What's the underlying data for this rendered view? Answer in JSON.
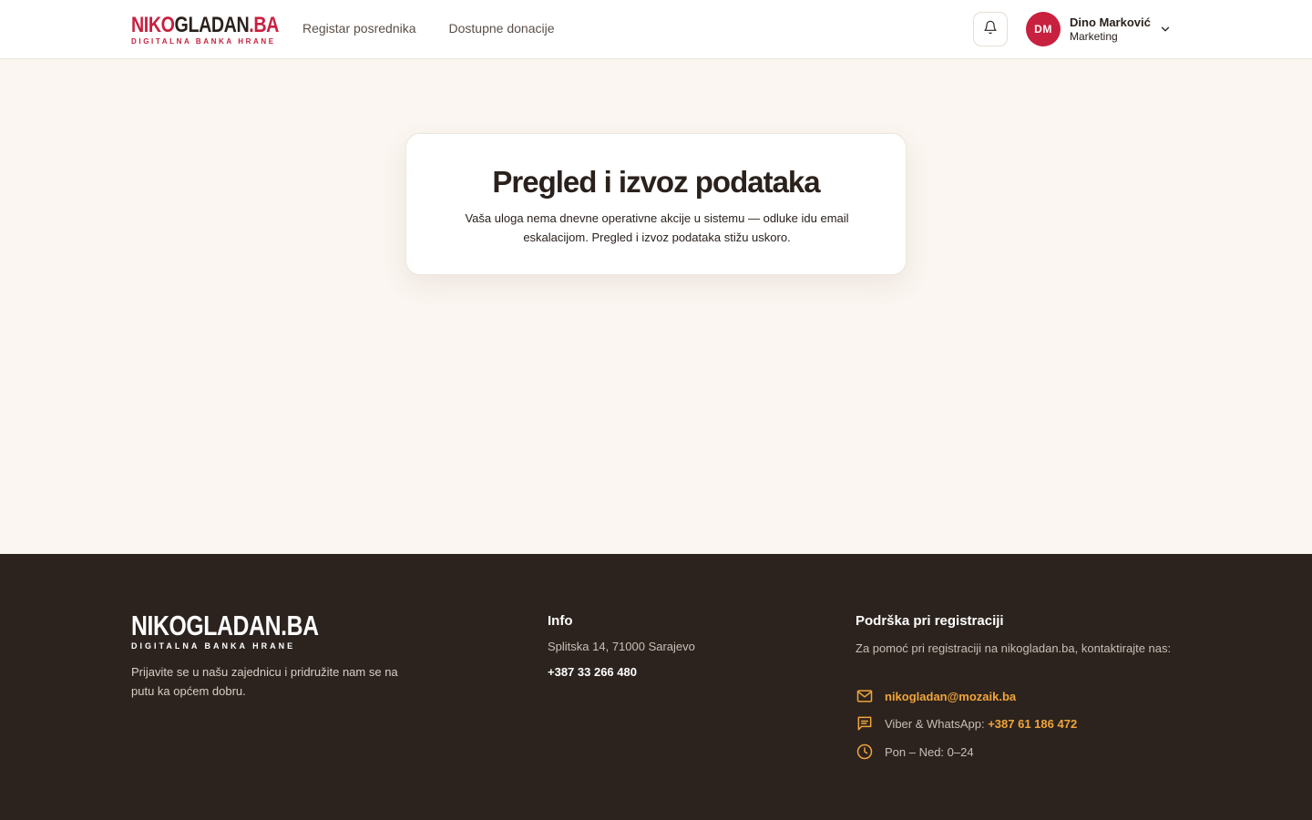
{
  "header": {
    "logo": {
      "part1": "NIKO",
      "part2": "GLADAN",
      "part3": ".BA",
      "tagline": "DIGITALNA BANKA HRANE"
    },
    "nav": [
      {
        "label": "Registar posrednika"
      },
      {
        "label": "Dostupne donacije"
      }
    ],
    "user": {
      "initials": "DM",
      "name": "Dino Marković",
      "role": "Marketing"
    }
  },
  "main": {
    "title": "Pregled i izvoz podataka",
    "description": "Vaša uloga nema dnevne operativne akcije u sistemu — odluke idu email eskalacijom. Pregled i izvoz podataka stižu uskoro."
  },
  "footer": {
    "logo": {
      "main": "NIKOGLADAN.BA",
      "tagline": "DIGITALNA BANKA HRANE"
    },
    "description": "Prijavite se u našu zajednicu i pridružite nam se na putu ka općem dobru.",
    "info": {
      "title": "Info",
      "address": "Splitska 14, 71000 Sarajevo",
      "phone": "+387 33 266 480"
    },
    "support": {
      "title": "Podrška pri registraciji",
      "description": "Za pomoć pri registraciji na nikogladan.ba, kontaktirajte nas:",
      "email": "nikogladan@mozaik.ba",
      "messaging_label": "Viber & WhatsApp:",
      "messaging_number": "+387 61 186 472",
      "hours": "Pon – Ned: 0–24"
    }
  },
  "colors": {
    "brand_red": "#c8203f",
    "accent_orange": "#f0a53a",
    "footer_bg": "#2c231e",
    "page_bg": "#fbf6f1"
  },
  "icons": {
    "bell": "bell-icon",
    "chevron": "chevron-down-icon",
    "mail": "mail-icon",
    "chat": "chat-icon",
    "clock": "clock-icon"
  }
}
